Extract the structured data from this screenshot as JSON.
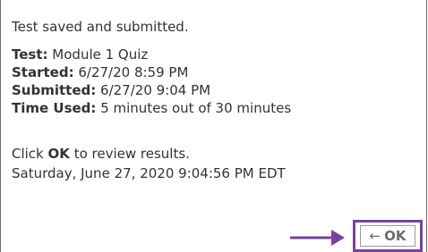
{
  "dialog": {
    "status": "Test saved and submitted.",
    "details": [
      {
        "label": "Test:",
        "value": "Module 1 Quiz"
      },
      {
        "label": "Started:",
        "value": "6/27/20 8:59 PM"
      },
      {
        "label": "Submitted:",
        "value": "6/27/20 9:04 PM"
      },
      {
        "label": "Time Used:",
        "value": "5 minutes out of 30 minutes"
      }
    ],
    "instruction_prefix": "Click",
    "instruction_keyword": "OK",
    "instruction_suffix": "to review results.",
    "timestamp": "Saturday, June 27, 2020 9:04:56 PM EDT"
  },
  "ok_button": {
    "icon": "back-arrow-icon",
    "icon_glyph": "←",
    "label": "OK"
  },
  "colors": {
    "highlight": "#7b3fa0",
    "text": "#333333"
  }
}
